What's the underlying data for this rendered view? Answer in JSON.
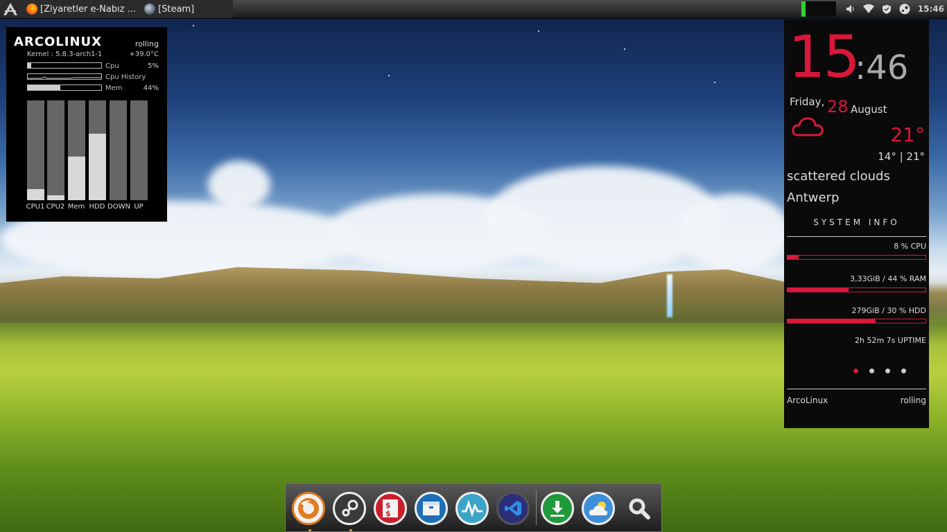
{
  "taskbar": {
    "tasks": [
      {
        "label": "[Ziyaretler e-Nabız ..."
      },
      {
        "label": "[Steam]"
      }
    ],
    "clock": "15:46"
  },
  "conky_left": {
    "title": "ARCOLINUX",
    "channel": "rolling",
    "kernel": "Kernel : 5.8.3-arch1-1",
    "temp": "+39.0°C",
    "cpu_label": "Cpu",
    "cpu_value": "5%",
    "cpu_percent": 5,
    "cpu_history_label": "Cpu History",
    "mem_label": "Mem",
    "mem_value": "44%",
    "mem_percent": 44,
    "vbars": [
      {
        "label": "CPU1",
        "level": 0.11
      },
      {
        "label": "CPU2",
        "level": 0.05
      },
      {
        "label": "Mem",
        "level": 0.44
      },
      {
        "label": "HDD",
        "level": 0.67
      },
      {
        "label": "DOWN",
        "level": 0
      },
      {
        "label": "UP",
        "level": 0
      }
    ]
  },
  "conky_right": {
    "hour": "15",
    "minute": ":46",
    "day": "Friday,",
    "date": "28",
    "month": "August",
    "temp": "21°",
    "range": "14° | 21°",
    "description": "scattered clouds",
    "city": "Antwerp",
    "system_info": "SYSTEM INFO",
    "stats": [
      {
        "label": "8 % CPU",
        "percent": 8
      },
      {
        "label": "3,33GiB / 44 % RAM",
        "percent": 44
      },
      {
        "label": "279GiB / 30 % HDD",
        "percent": 64
      }
    ],
    "uptime": "2h 52m 7s UPTIME",
    "footer_left": "ArcoLinux",
    "footer_right": "rolling",
    "accent": "#d8173b"
  },
  "dock": {
    "items": [
      {
        "name": "firefox-icon"
      },
      {
        "name": "steam-icon"
      },
      {
        "name": "money-manager-icon"
      },
      {
        "name": "archive-manager-icon"
      },
      {
        "name": "system-monitor-icon"
      },
      {
        "name": "vscode-icon"
      },
      {
        "name": "download-manager-icon"
      },
      {
        "name": "weather-icon"
      },
      {
        "name": "search-icon"
      }
    ]
  }
}
